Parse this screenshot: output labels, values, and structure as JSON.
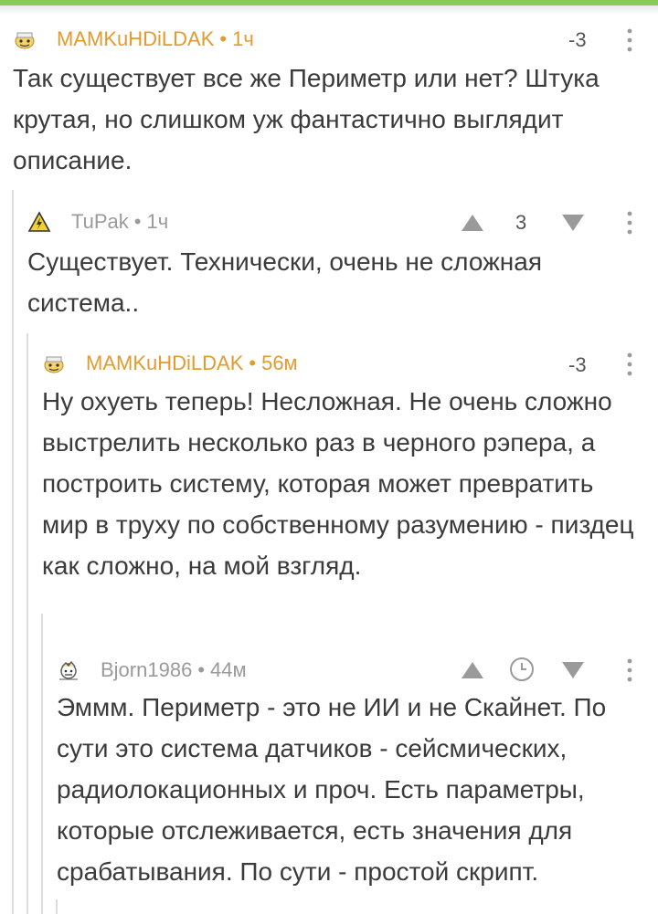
{
  "comments": [
    {
      "author": "MAMKuHDiLDAK",
      "separator": "•",
      "time": "1ч",
      "rating": "-3",
      "text": "Так существует все же Периметр или нет? Штука крутая, но слишком уж фантастично выглядит описание."
    },
    {
      "author": "TuPak",
      "separator": "•",
      "time": "1ч",
      "rating": "3",
      "text": "Существует. Технически, очень не сложная система.."
    },
    {
      "author": "MAMKuHDiLDAK",
      "separator": "•",
      "time": "56м",
      "rating": "-3",
      "text": "Ну охуеть теперь! Несложная. Не очень сложно выстрелить несколько раз в черного рэпера, а построить систему, которая может превратить мир в труху по собственному разумению - пиздец как сложно, на мой взгляд."
    },
    {
      "author": "Bjorn1986",
      "separator": "•",
      "time": "44м",
      "rating": "",
      "text": "Эммм. Периметр - это не ИИ и не Скайнет. По сути это система датчиков - сейсмических, радиолокационных и проч. Есть параметры, которые отслеживается, есть значения для срабатывания. По сути - простой скрипт."
    }
  ],
  "colors": {
    "accent_green": "#8ac858",
    "author_orange": "#e59a2e",
    "author_gray": "#9a9a9a",
    "text": "#3b3b3b",
    "thread_line": "#dcdcdc"
  },
  "icons": {
    "avatar_1": "cartoon-face-avatar",
    "avatar_2": "warning-sign-avatar",
    "avatar_3": "cartoon-face-avatar",
    "avatar_4": "sketch-avatar",
    "upvote": "triangle-up-icon",
    "downvote": "triangle-down-icon",
    "pending": "clock-icon",
    "menu": "kebab-more-icon"
  }
}
